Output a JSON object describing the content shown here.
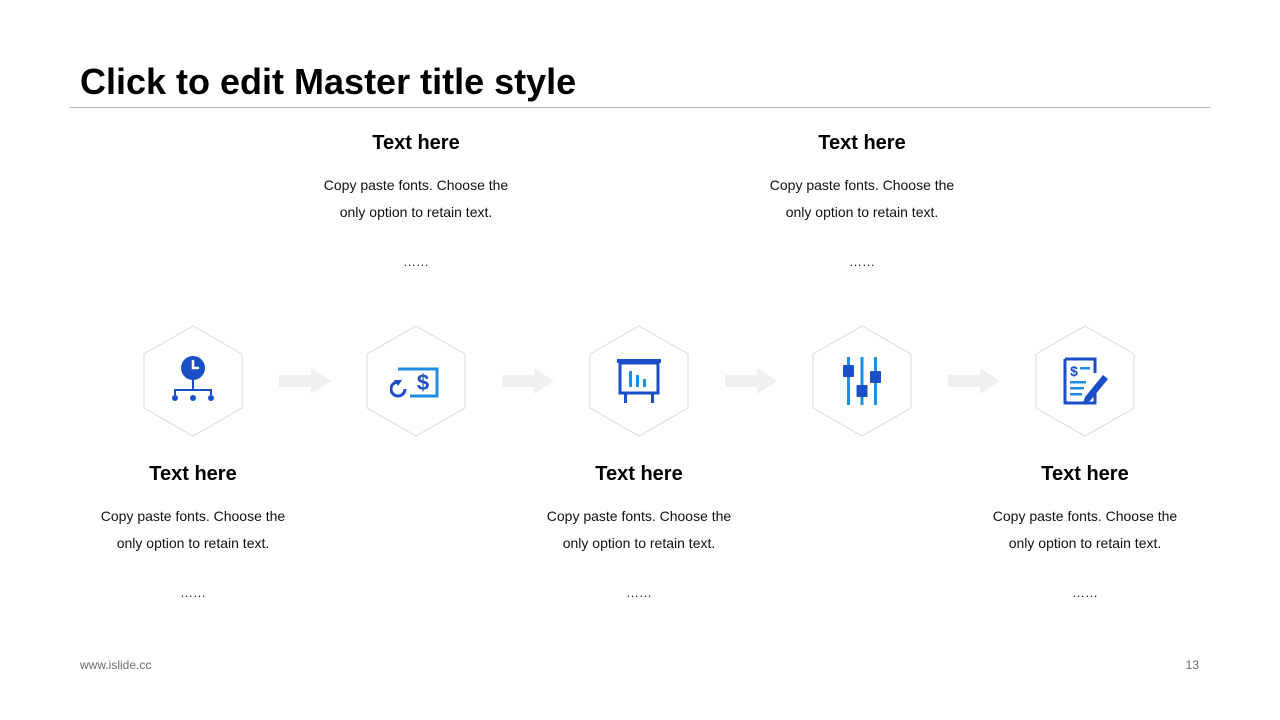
{
  "slide": {
    "title": "Click to edit Master title style",
    "footer_url": "www.islide.cc",
    "page_number": "13"
  },
  "steps": [
    {
      "heading": "Text here",
      "body": "Copy paste fonts. Choose the only option to retain text.",
      "dots": "…… ",
      "icon": "clock-hierarchy-icon",
      "position": "bottom"
    },
    {
      "heading": "Text here",
      "body": "Copy paste fonts. Choose the only option to retain text.",
      "dots": "……",
      "icon": "dollar-refresh-icon",
      "position": "top"
    },
    {
      "heading": "Text here",
      "body": "Copy paste fonts. Choose the only option to retain text.",
      "dots": "……",
      "icon": "presentation-board-icon",
      "position": "bottom"
    },
    {
      "heading": "Text here",
      "body": "Copy paste fonts. Choose the only option to retain text.",
      "dots": "……",
      "icon": "sliders-icon",
      "position": "top"
    },
    {
      "heading": "Text here",
      "body": "Copy paste fonts. Choose the only option to retain text.",
      "dots": "……",
      "icon": "invoice-pen-icon",
      "position": "bottom"
    }
  ],
  "colors": {
    "icon_blue_dark": "#1a4fc8",
    "icon_blue_light": "#1e8ee0",
    "hex_border": "#d9d9d9",
    "arrow": "#f0f0f0"
  }
}
